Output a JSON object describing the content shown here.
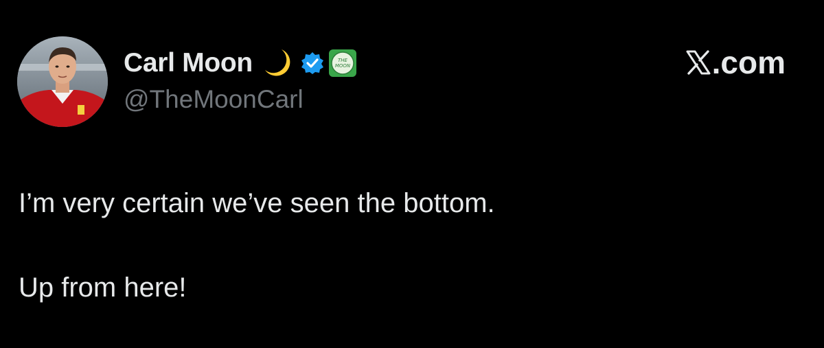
{
  "author": {
    "display_name": "Carl Moon",
    "handle": "@TheMoonCarl",
    "avatar": "avatar-photo",
    "emoji": "crescent-moon-icon",
    "verified_color": "#1d9bf0",
    "affiliate_badge_text_1": "THE",
    "affiliate_badge_text_2": "MOON"
  },
  "site": {
    "label": ".com",
    "logo": "x-logo-icon"
  },
  "tweet": {
    "line_1": "I’m very certain we’ve seen the bottom.",
    "line_2": "Up from here!"
  },
  "colors": {
    "background": "#000000",
    "primary_text": "#e7e9ea",
    "secondary_text": "#71767b",
    "verified": "#1d9bf0",
    "moon": "#ffcc33",
    "badge_green": "#3aa64a"
  }
}
